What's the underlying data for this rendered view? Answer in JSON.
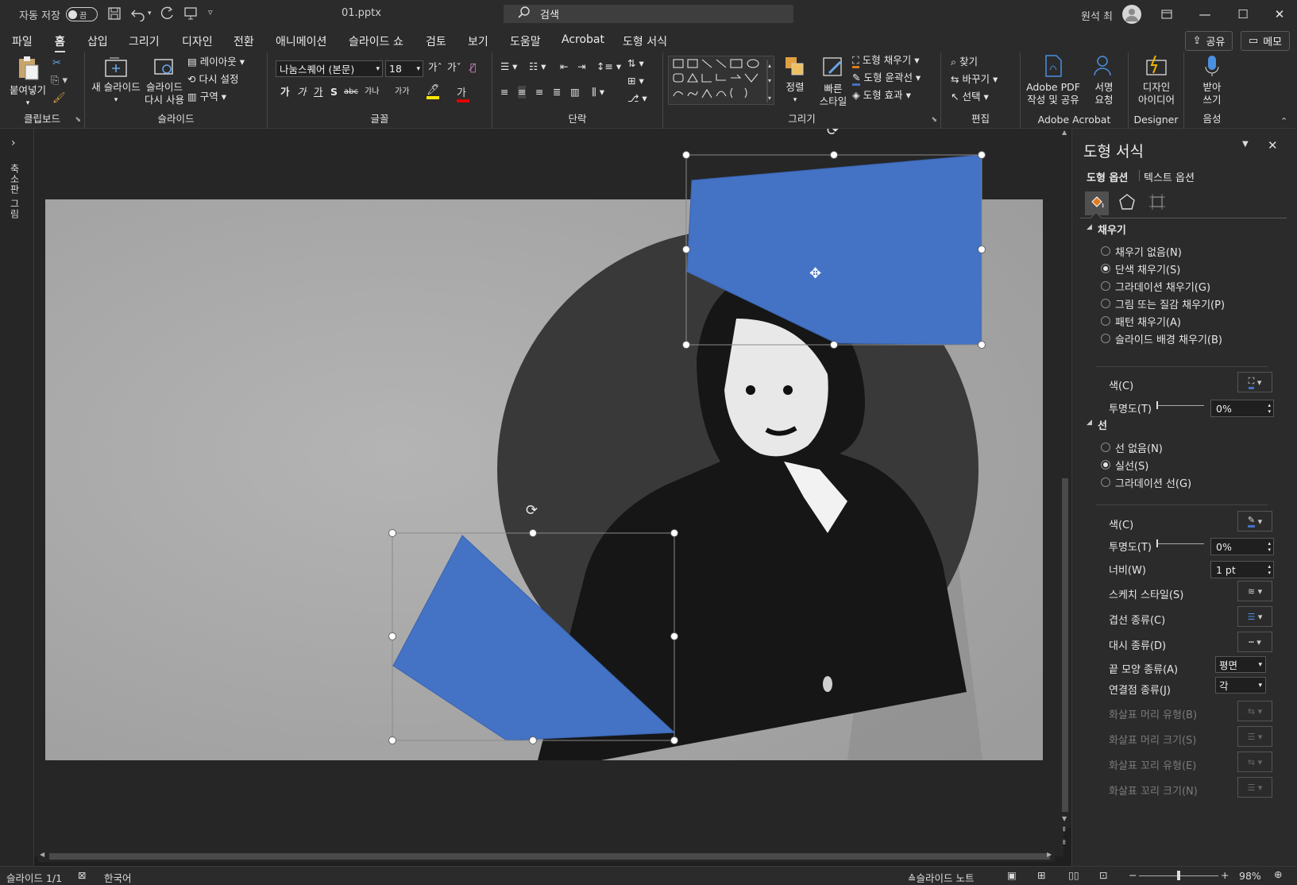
{
  "titlebar": {
    "autosave_label": "자동 저장",
    "autosave_state": "끔",
    "filename": "01.pptx",
    "search_placeholder": "검색",
    "user_name": "원석 최"
  },
  "menu": {
    "items": [
      "파일",
      "홈",
      "삽입",
      "그리기",
      "디자인",
      "전환",
      "애니메이션",
      "슬라이드 쇼",
      "검토",
      "보기",
      "도움말",
      "Acrobat",
      "도형 서식"
    ],
    "active_index": 1,
    "share_label": "공유",
    "memo_label": "메모"
  },
  "ribbon": {
    "clipboard": {
      "paste": "붙여넣기",
      "label": "클립보드"
    },
    "slides": {
      "new_slide": "새 슬라이드",
      "reuse": "슬라이드\n다시 사용",
      "layout": "레이아웃",
      "reset": "다시 설정",
      "section": "구역",
      "label": "슬라이드"
    },
    "font": {
      "font_name": "나눔스퀘어 (본문)",
      "font_size": "18",
      "label": "글꼴",
      "bold": "가",
      "italic": "가",
      "underline": "가",
      "shadow": "S",
      "strike": "abc",
      "spacing": "갸나",
      "case": "가가",
      "font_color_glyph": "가"
    },
    "paragraph": {
      "label": "단락"
    },
    "drawing": {
      "arrange": "정렬",
      "quick_styles": "빠른\n스타일",
      "shape_fill": "도형 채우기",
      "shape_outline": "도형 윤곽선",
      "shape_effects": "도형 효과",
      "label": "그리기"
    },
    "editing": {
      "find": "찾기",
      "replace": "바꾸기",
      "select": "선택",
      "label": "편집"
    },
    "acrobat": {
      "create_pdf": "Adobe PDF\n작성 및 공유",
      "sign": "서명\n요청",
      "label": "Adobe Acrobat"
    },
    "designer": {
      "ideas": "디자인\n아이디어",
      "label": "Designer"
    },
    "voice": {
      "dictate": "받아\n쓰기",
      "label": "음성"
    }
  },
  "rail": {
    "label": "축소판 그림"
  },
  "pane": {
    "title": "도형 서식",
    "tab_shape": "도형 옵션",
    "tab_text": "텍스트 옵션",
    "fill_section": "채우기",
    "fill_options": [
      "채우기 없음(N)",
      "단색 채우기(S)",
      "그라데이션 채우기(G)",
      "그림 또는 질감 채우기(P)",
      "패턴 채우기(A)",
      "슬라이드 배경 채우기(B)"
    ],
    "fill_selected": 1,
    "fill_color_label": "색(C)",
    "fill_transparency_label": "투명도(T)",
    "fill_transparency": "0%",
    "line_section": "선",
    "line_options": [
      "선 없음(N)",
      "실선(S)",
      "그라데이션 선(G)"
    ],
    "line_selected": 1,
    "line_color_label": "색(C)",
    "line_transparency_label": "투명도(T)",
    "line_transparency": "0%",
    "width_label": "너비(W)",
    "width_value": "1 pt",
    "sketch_label": "스케치 스타일(S)",
    "compound_label": "겹선 종류(C)",
    "dash_label": "대시 종류(D)",
    "cap_label": "끝 모양 종류(A)",
    "cap_value": "평면",
    "join_label": "연결점 종류(J)",
    "join_value": "각",
    "arrow_begin_type": "화살표 머리 유형(B)",
    "arrow_begin_size": "화살표 머리 크기(S)",
    "arrow_end_type": "화살표 꼬리 유형(E)",
    "arrow_end_size": "화살표 꼬리 크기(N)"
  },
  "status": {
    "slide_info": "슬라이드 1/1",
    "language": "한국어",
    "notes": "슬라이드 노트",
    "zoom": "98%"
  },
  "colors": {
    "accent_blue": "#4472c4",
    "slide_bg": "#a5a5a5",
    "circle": "#3a3a3a"
  }
}
